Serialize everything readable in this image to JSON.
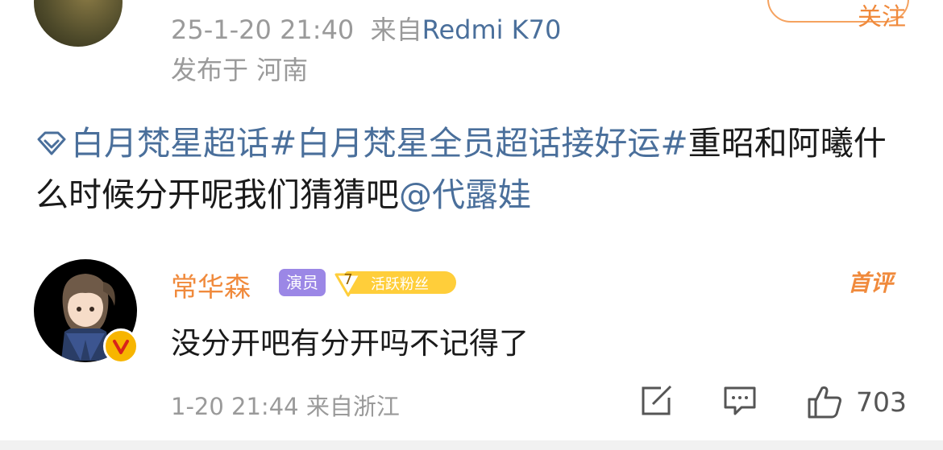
{
  "post": {
    "datetime": "25-1-20 21:40",
    "source_prefix": "来自",
    "device": "Redmi K70",
    "location": "发布于 河南",
    "topic1": "白月梵星超话",
    "topic2": "#白月梵星全员超话接好运#",
    "text": "重昭和阿曦什么时候分开呢我们猜猜吧",
    "mention": "@代露娃"
  },
  "follow_button": {
    "label": "关注"
  },
  "comment": {
    "author": "常华森",
    "role_badge": "演员",
    "fan_level": "7",
    "fan_badge": "活跃粉丝",
    "first_comment_tag": "首评",
    "text": "没分开吧有分开吗不记得了",
    "time": "1-20 21:44",
    "location": "来自浙江",
    "like_count": "703"
  },
  "colors": {
    "link": "#4a6f9b",
    "accent": "#f08a3c",
    "meta": "#9a9a9a",
    "role_badge": "#9b87e6",
    "fan_badge": "#ffce3a"
  },
  "icons": {
    "topic": "supertopic-diamond-icon",
    "verified": "verified-v-icon",
    "share": "share-icon",
    "reply": "comment-icon",
    "like": "thumbs-up-icon"
  }
}
